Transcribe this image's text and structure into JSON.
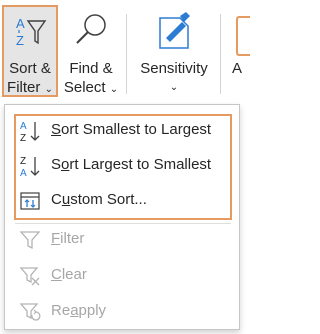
{
  "ribbon": {
    "sort_filter": {
      "line1": "Sort &",
      "line2": "Filter",
      "chevron": "⌄",
      "icon": "sort-filter-icon"
    },
    "find_select": {
      "line1": "Find &",
      "line2": "Select",
      "chevron": "⌄",
      "icon": "magnifier-icon"
    },
    "sensitivity": {
      "label": "Sensitivity",
      "chevron": "⌄",
      "icon": "sensitivity-icon"
    },
    "partial": {
      "label": "A"
    }
  },
  "menu": {
    "sort_asc": {
      "accel": "S",
      "rest": "ort Smallest to Largest"
    },
    "sort_desc": {
      "prefix": "S",
      "accel": "o",
      "rest": "rt Largest to Smallest"
    },
    "custom_sort": {
      "prefix": "C",
      "accel": "u",
      "rest": "stom Sort..."
    },
    "filter": {
      "accel": "F",
      "rest": "ilter"
    },
    "clear": {
      "accel": "C",
      "rest": "lear"
    },
    "reapply": {
      "prefix": "Re",
      "accel": "a",
      "rest": "pply"
    }
  },
  "colors": {
    "highlight_border": "#e49a60",
    "accent_blue": "#2b7cd3",
    "disabled_text": "#a6a6a6"
  }
}
